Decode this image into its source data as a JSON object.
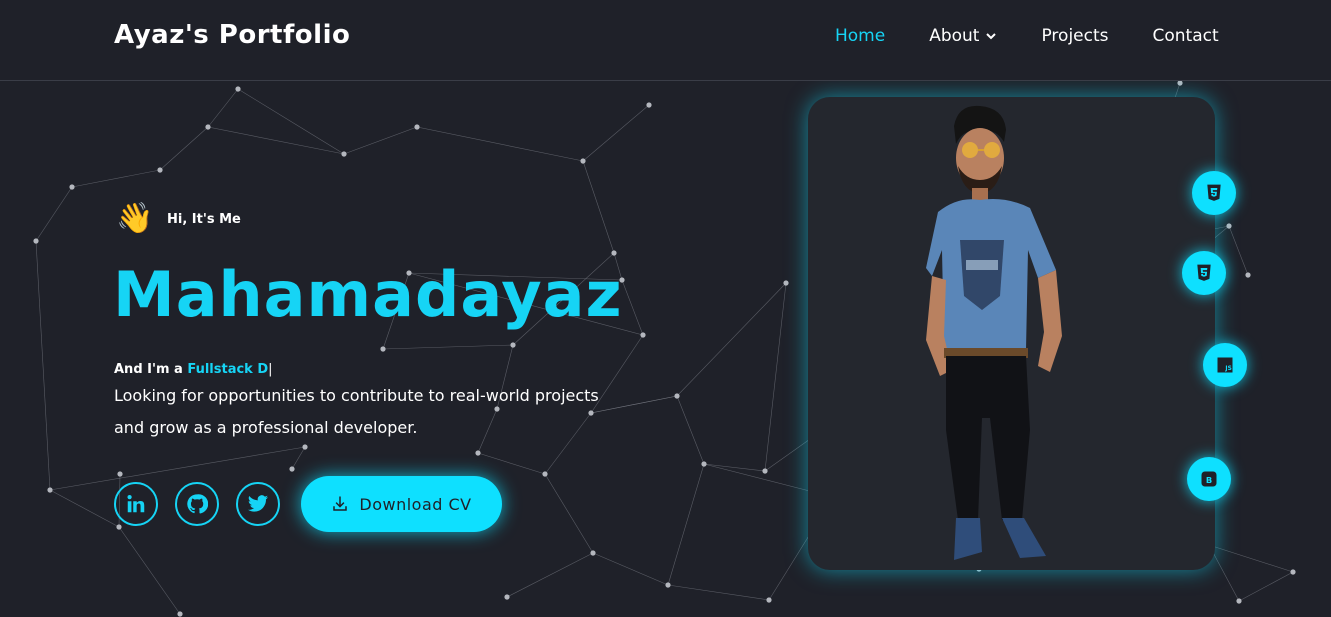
{
  "nav": {
    "brand": "Ayaz's Portfolio",
    "links": [
      {
        "label": "Home",
        "active": true
      },
      {
        "label": "About",
        "dropdown": true
      },
      {
        "label": "Projects"
      },
      {
        "label": "Contact"
      }
    ]
  },
  "hero": {
    "greeting": "Hi, It's Me",
    "name": "Mahamadayaz",
    "role_prefix": "And I'm a ",
    "role_typed": "Fullstack D",
    "role_cursor": "|",
    "description": "Looking for opportunities to contribute to real-world projects and grow as a professional developer.",
    "download_label": "Download CV",
    "socials": [
      "linkedin-icon",
      "github-icon",
      "twitter-icon"
    ]
  },
  "tech_badges": [
    "html5-icon",
    "css3-icon",
    "javascript-icon",
    "bootstrap-icon"
  ],
  "colors": {
    "accent": "#16d4f5",
    "background": "#1f2129"
  }
}
